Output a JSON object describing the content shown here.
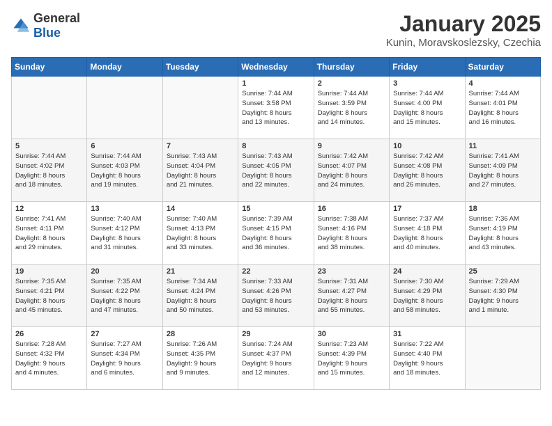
{
  "logo": {
    "general": "General",
    "blue": "Blue"
  },
  "title": "January 2025",
  "location": "Kunin, Moravskoslezsky, Czechia",
  "headers": [
    "Sunday",
    "Monday",
    "Tuesday",
    "Wednesday",
    "Thursday",
    "Friday",
    "Saturday"
  ],
  "weeks": [
    [
      {
        "day": "",
        "info": ""
      },
      {
        "day": "",
        "info": ""
      },
      {
        "day": "",
        "info": ""
      },
      {
        "day": "1",
        "info": "Sunrise: 7:44 AM\nSunset: 3:58 PM\nDaylight: 8 hours\nand 13 minutes."
      },
      {
        "day": "2",
        "info": "Sunrise: 7:44 AM\nSunset: 3:59 PM\nDaylight: 8 hours\nand 14 minutes."
      },
      {
        "day": "3",
        "info": "Sunrise: 7:44 AM\nSunset: 4:00 PM\nDaylight: 8 hours\nand 15 minutes."
      },
      {
        "day": "4",
        "info": "Sunrise: 7:44 AM\nSunset: 4:01 PM\nDaylight: 8 hours\nand 16 minutes."
      }
    ],
    [
      {
        "day": "5",
        "info": "Sunrise: 7:44 AM\nSunset: 4:02 PM\nDaylight: 8 hours\nand 18 minutes."
      },
      {
        "day": "6",
        "info": "Sunrise: 7:44 AM\nSunset: 4:03 PM\nDaylight: 8 hours\nand 19 minutes."
      },
      {
        "day": "7",
        "info": "Sunrise: 7:43 AM\nSunset: 4:04 PM\nDaylight: 8 hours\nand 21 minutes."
      },
      {
        "day": "8",
        "info": "Sunrise: 7:43 AM\nSunset: 4:05 PM\nDaylight: 8 hours\nand 22 minutes."
      },
      {
        "day": "9",
        "info": "Sunrise: 7:42 AM\nSunset: 4:07 PM\nDaylight: 8 hours\nand 24 minutes."
      },
      {
        "day": "10",
        "info": "Sunrise: 7:42 AM\nSunset: 4:08 PM\nDaylight: 8 hours\nand 26 minutes."
      },
      {
        "day": "11",
        "info": "Sunrise: 7:41 AM\nSunset: 4:09 PM\nDaylight: 8 hours\nand 27 minutes."
      }
    ],
    [
      {
        "day": "12",
        "info": "Sunrise: 7:41 AM\nSunset: 4:11 PM\nDaylight: 8 hours\nand 29 minutes."
      },
      {
        "day": "13",
        "info": "Sunrise: 7:40 AM\nSunset: 4:12 PM\nDaylight: 8 hours\nand 31 minutes."
      },
      {
        "day": "14",
        "info": "Sunrise: 7:40 AM\nSunset: 4:13 PM\nDaylight: 8 hours\nand 33 minutes."
      },
      {
        "day": "15",
        "info": "Sunrise: 7:39 AM\nSunset: 4:15 PM\nDaylight: 8 hours\nand 36 minutes."
      },
      {
        "day": "16",
        "info": "Sunrise: 7:38 AM\nSunset: 4:16 PM\nDaylight: 8 hours\nand 38 minutes."
      },
      {
        "day": "17",
        "info": "Sunrise: 7:37 AM\nSunset: 4:18 PM\nDaylight: 8 hours\nand 40 minutes."
      },
      {
        "day": "18",
        "info": "Sunrise: 7:36 AM\nSunset: 4:19 PM\nDaylight: 8 hours\nand 43 minutes."
      }
    ],
    [
      {
        "day": "19",
        "info": "Sunrise: 7:35 AM\nSunset: 4:21 PM\nDaylight: 8 hours\nand 45 minutes."
      },
      {
        "day": "20",
        "info": "Sunrise: 7:35 AM\nSunset: 4:22 PM\nDaylight: 8 hours\nand 47 minutes."
      },
      {
        "day": "21",
        "info": "Sunrise: 7:34 AM\nSunset: 4:24 PM\nDaylight: 8 hours\nand 50 minutes."
      },
      {
        "day": "22",
        "info": "Sunrise: 7:33 AM\nSunset: 4:26 PM\nDaylight: 8 hours\nand 53 minutes."
      },
      {
        "day": "23",
        "info": "Sunrise: 7:31 AM\nSunset: 4:27 PM\nDaylight: 8 hours\nand 55 minutes."
      },
      {
        "day": "24",
        "info": "Sunrise: 7:30 AM\nSunset: 4:29 PM\nDaylight: 8 hours\nand 58 minutes."
      },
      {
        "day": "25",
        "info": "Sunrise: 7:29 AM\nSunset: 4:30 PM\nDaylight: 9 hours\nand 1 minute."
      }
    ],
    [
      {
        "day": "26",
        "info": "Sunrise: 7:28 AM\nSunset: 4:32 PM\nDaylight: 9 hours\nand 4 minutes."
      },
      {
        "day": "27",
        "info": "Sunrise: 7:27 AM\nSunset: 4:34 PM\nDaylight: 9 hours\nand 6 minutes."
      },
      {
        "day": "28",
        "info": "Sunrise: 7:26 AM\nSunset: 4:35 PM\nDaylight: 9 hours\nand 9 minutes."
      },
      {
        "day": "29",
        "info": "Sunrise: 7:24 AM\nSunset: 4:37 PM\nDaylight: 9 hours\nand 12 minutes."
      },
      {
        "day": "30",
        "info": "Sunrise: 7:23 AM\nSunset: 4:39 PM\nDaylight: 9 hours\nand 15 minutes."
      },
      {
        "day": "31",
        "info": "Sunrise: 7:22 AM\nSunset: 4:40 PM\nDaylight: 9 hours\nand 18 minutes."
      },
      {
        "day": "",
        "info": ""
      }
    ]
  ]
}
